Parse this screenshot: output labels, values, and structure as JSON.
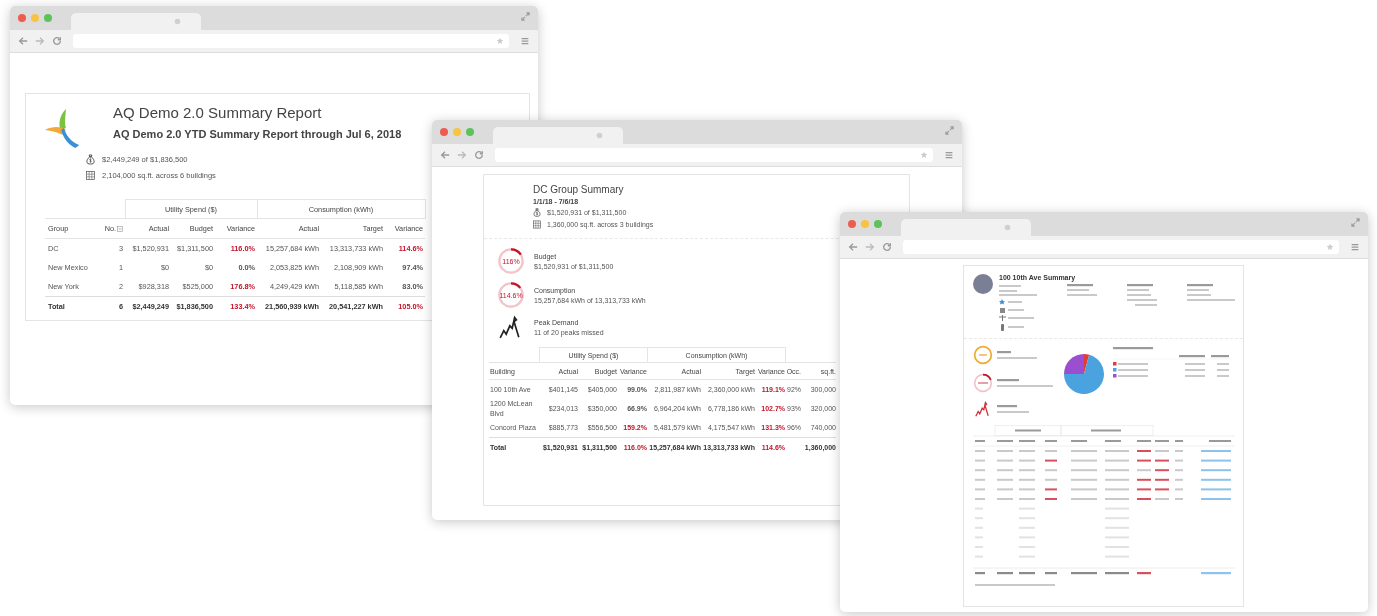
{
  "report_window": {
    "title": "AQ Demo 2.0 Summary Report",
    "subtitle": "AQ Demo 2.0 YTD Summary Report through Jul 6, 2018",
    "stats": [
      {
        "kind": "money",
        "text": "$2,449,249 of $1,836,500"
      },
      {
        "kind": "area",
        "text": "2,104,000 sq.ft. across 6 buildings"
      }
    ],
    "table": {
      "leading_columns": [
        "Group",
        "No."
      ],
      "column_groups": [
        {
          "label": "Utility Spend ($)",
          "columns": [
            "Actual",
            "Budget",
            "Variance"
          ]
        },
        {
          "label": "Consumption (kWh)",
          "columns": [
            "Actual",
            "Target",
            "Variance"
          ]
        }
      ],
      "rows": [
        {
          "kind": "data",
          "label": "DC",
          "count": "3",
          "actual": "$1,520,931",
          "budget": "$1,311,500",
          "variance": "116.0%",
          "variance_over": true,
          "usage": "15,257,684 kWh",
          "target": "13,313,733 kWh",
          "usage_variance": "114.6%",
          "usage_variance_over": true
        },
        {
          "kind": "data",
          "label": "New Mexico",
          "count": "1",
          "actual": "$0",
          "budget": "$0",
          "variance": "0.0%",
          "variance_over": false,
          "usage": "2,053,825 kWh",
          "target": "2,108,909 kWh",
          "usage_variance": "97.4%",
          "usage_variance_over": false
        },
        {
          "kind": "data",
          "label": "New York",
          "count": "2",
          "actual": "$928,318",
          "budget": "$525,000",
          "variance": "176.8%",
          "variance_over": true,
          "usage": "4,249,429 kWh",
          "target": "5,118,585 kWh",
          "usage_variance": "83.0%",
          "usage_variance_over": false
        },
        {
          "kind": "total",
          "label": "Total",
          "count": "6",
          "actual": "$2,449,249",
          "budget": "$1,836,500",
          "variance": "133.4%",
          "variance_over": true,
          "usage": "21,560,939 kWh",
          "target": "20,541,227 kWh",
          "usage_variance": "105.0%",
          "usage_variance_over": true
        }
      ]
    }
  },
  "group_window": {
    "title": "DC Group Summary",
    "period": "1/1/18 - 7/6/18",
    "stats": [
      {
        "kind": "money",
        "text": "$1,520,931 of $1,311,500"
      },
      {
        "kind": "area",
        "text": "1,360,000 sq.ft. across 3 buildings"
      }
    ],
    "metrics": [
      {
        "kind": "gauge",
        "value": "116%",
        "level": 0.16,
        "over": true,
        "label": "Budget",
        "detail": "$1,520,931 of $1,311,500"
      },
      {
        "kind": "gauge",
        "value": "114.6%",
        "level": 0.146,
        "over": true,
        "label": "Consumption",
        "detail": "15,257,684 kWh of 13,313,733 kWh"
      },
      {
        "kind": "peak",
        "label": "Peak Demand",
        "detail": "11 of 20 peaks missed"
      }
    ],
    "table": {
      "leading_columns": [
        "Building"
      ],
      "column_groups": [
        {
          "label": "Utility Spend ($)",
          "columns": [
            "Actual",
            "Budget",
            "Variance"
          ]
        },
        {
          "label": "Consumption (kWh)",
          "columns": [
            "Actual",
            "Target",
            "Variance"
          ]
        }
      ],
      "trailing_columns": [
        "Occ.",
        "sq.ft."
      ],
      "rows": [
        {
          "kind": "data",
          "label": "100 10th Ave",
          "actual": "$401,145",
          "budget": "$405,000",
          "variance": "99.0%",
          "variance_over": false,
          "usage": "2,811,987 kWh",
          "target": "2,360,000 kWh",
          "usage_variance": "119.1%",
          "usage_variance_over": true,
          "occ": "92%",
          "sqft": "300,000"
        },
        {
          "kind": "data",
          "label": "1200 McLean Blvd",
          "actual": "$234,013",
          "budget": "$350,000",
          "variance": "66.9%",
          "variance_over": false,
          "usage": "6,964,204 kWh",
          "target": "6,778,186 kWh",
          "usage_variance": "102.7%",
          "usage_variance_over": true,
          "occ": "93%",
          "sqft": "320,000"
        },
        {
          "kind": "data",
          "label": "Concord Plaza",
          "actual": "$885,773",
          "budget": "$556,500",
          "variance": "159.2%",
          "variance_over": true,
          "usage": "5,481,579 kWh",
          "target": "4,175,547 kWh",
          "usage_variance": "131.3%",
          "usage_variance_over": true,
          "occ": "96%",
          "sqft": "740,000"
        },
        {
          "kind": "total",
          "label": "Total",
          "actual": "$1,520,931",
          "budget": "$1,311,500",
          "variance": "116.0%",
          "variance_over": true,
          "usage": "15,257,684 kWh",
          "target": "13,313,733 kWh",
          "usage_variance": "114.6%",
          "usage_variance_over": true,
          "sqft": "1,360,000"
        }
      ]
    }
  },
  "building_window": {
    "title": "100 10th Ave Summary"
  }
}
